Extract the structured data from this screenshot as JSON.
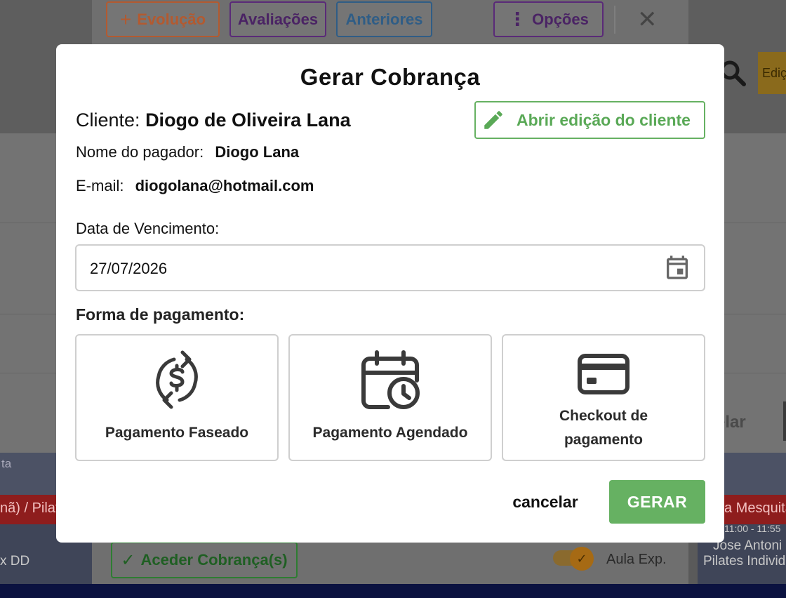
{
  "background": {
    "toolbar": {
      "evolucao_label": "Evolução",
      "avaliacoes_label": "Avaliações",
      "anteriores_label": "Anteriores",
      "opcoes_label": "Opções",
      "close_glyph": "✕"
    },
    "edicao_label": "Ediç",
    "strip_text_left": "ta",
    "red_left_text": "nã) / Pilate",
    "red_right_text": "a Mesquita",
    "dark_left_text": "x DD",
    "dark_right_time": "11:00 - 11:55",
    "dark_right_name": "Jose Antoni",
    "dark_right_class": "Pilates Individ",
    "aceder_label": "Aceder Cobrança(s)",
    "aula_label": "Aula Exp.",
    "celar_text": "elar"
  },
  "modal": {
    "title": "Gerar Cobrança",
    "client_label": "Cliente:",
    "client_name": "Diogo de Oliveira Lana",
    "edit_client_label": "Abrir edição do cliente",
    "payer_label": "Nome do pagador:",
    "payer_name": "Diogo Lana",
    "email_label": "E-mail:",
    "email_value": "diogolana@hotmail.com",
    "due_date_label": "Data de Vencimento:",
    "due_date_value": "27/07/2026",
    "payment_method_label": "Forma de pagamento:",
    "payment_options": [
      {
        "label": "Pagamento Faseado",
        "icon": "dollar-refresh-icon"
      },
      {
        "label": "Pagamento Agendado",
        "icon": "calendar-clock-icon"
      },
      {
        "label": "Checkout de pagamento",
        "line1": "Checkout de",
        "line2": "pagamento",
        "icon": "credit-card-icon"
      }
    ],
    "cancel_label": "cancelar",
    "submit_label": "GERAR"
  },
  "colors": {
    "accent_green": "#66b162",
    "overlay": "#5a5a5a",
    "border_gray": "#cfcfcf"
  }
}
